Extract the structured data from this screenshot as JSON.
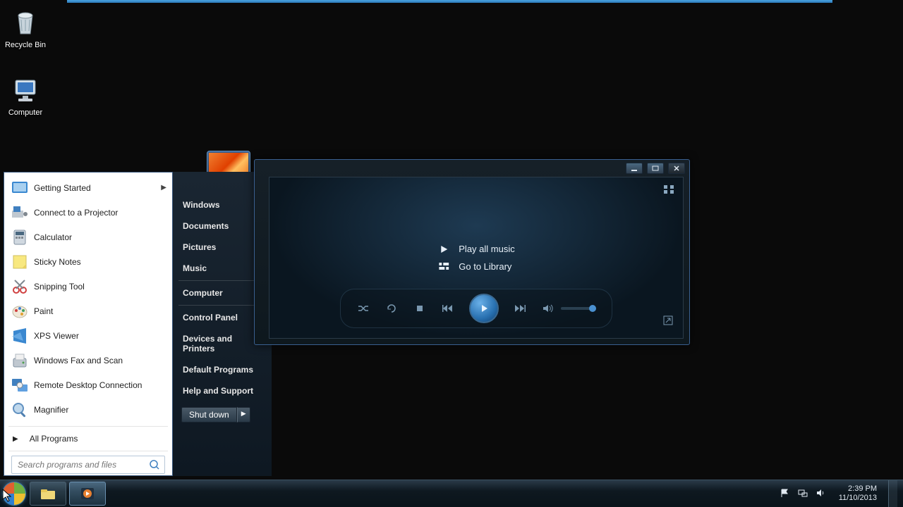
{
  "desktop": {
    "icons": [
      {
        "name": "recycle-bin",
        "label": "Recycle Bin"
      },
      {
        "name": "computer",
        "label": "Computer"
      }
    ]
  },
  "startmenu": {
    "items": [
      {
        "label": "Getting Started",
        "has_arrow": true
      },
      {
        "label": "Connect to a Projector",
        "has_arrow": false
      },
      {
        "label": "Calculator",
        "has_arrow": false
      },
      {
        "label": "Sticky Notes",
        "has_arrow": false
      },
      {
        "label": "Snipping Tool",
        "has_arrow": false
      },
      {
        "label": "Paint",
        "has_arrow": false
      },
      {
        "label": "XPS Viewer",
        "has_arrow": false
      },
      {
        "label": "Windows Fax and Scan",
        "has_arrow": false
      },
      {
        "label": "Remote Desktop Connection",
        "has_arrow": false
      },
      {
        "label": "Magnifier",
        "has_arrow": false
      }
    ],
    "all_programs": "All Programs",
    "search_placeholder": "Search programs and files",
    "right": {
      "user": "Windows",
      "links": [
        "Documents",
        "Pictures",
        "Music",
        "Computer",
        "Control Panel",
        "Devices and Printers",
        "Default Programs",
        "Help and Support"
      ]
    },
    "shutdown": "Shut down"
  },
  "wmp": {
    "play_all": "Play all music",
    "go_library": "Go to Library"
  },
  "tray": {
    "time": "2:39 PM",
    "date": "11/10/2013"
  }
}
